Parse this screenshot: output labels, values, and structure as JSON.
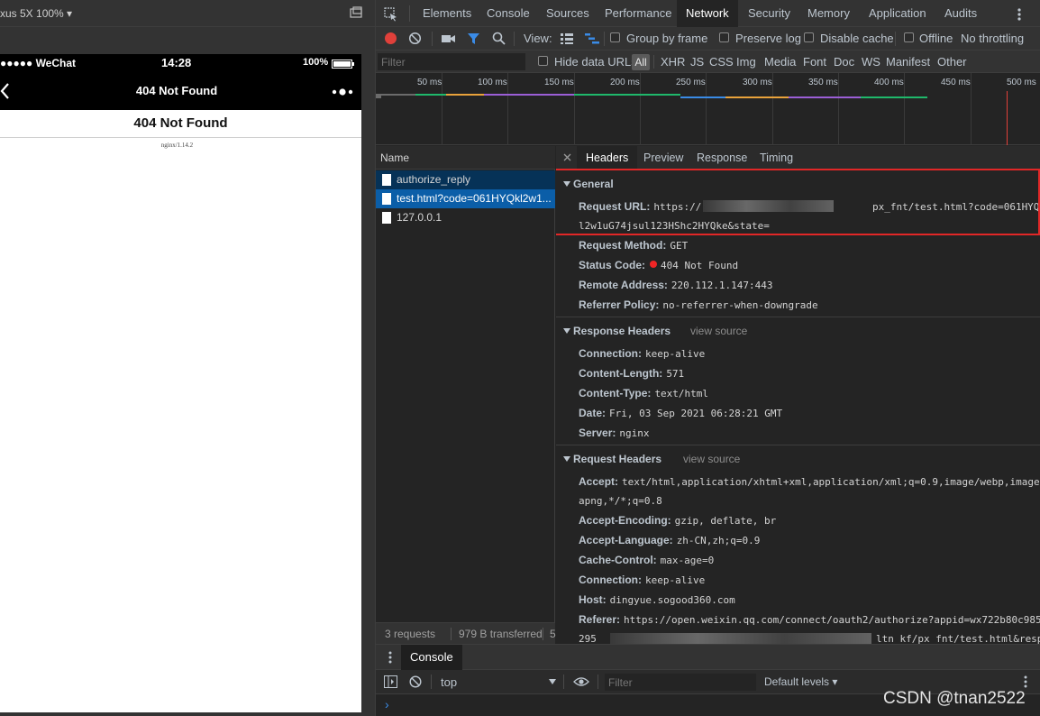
{
  "device": {
    "label": "xus 5X 100% ▾",
    "status_carrier": "●●●●● WeChat",
    "status_time": "14:28",
    "status_battery": "100%",
    "nav_title": "404 Not Found",
    "page_heading": "404 Not Found",
    "page_footer": "nginx/1.14.2"
  },
  "devtools_tabs": [
    "Elements",
    "Console",
    "Sources",
    "Performance",
    "Network",
    "Security",
    "Memory",
    "Application",
    "Audits"
  ],
  "active_tab": "Network",
  "network_toolbar": {
    "view_label": "View:",
    "group_by_frame": "Group by frame",
    "preserve_log": "Preserve log",
    "disable_cache": "Disable cache",
    "offline": "Offline",
    "throttling": "No throttling"
  },
  "filter_bar": {
    "placeholder": "Filter",
    "hide_data_urls": "Hide data URLs",
    "types": [
      "All",
      "XHR",
      "JS",
      "CSS",
      "Img",
      "Media",
      "Font",
      "Doc",
      "WS",
      "Manifest",
      "Other"
    ]
  },
  "timeline_ticks": [
    "50 ms",
    "100 ms",
    "150 ms",
    "200 ms",
    "250 ms",
    "300 ms",
    "350 ms",
    "400 ms",
    "450 ms",
    "500 ms"
  ],
  "requests": {
    "column": "Name",
    "rows": [
      "authorize_reply",
      "test.html?code=061HYQkl2w1...",
      "127.0.0.1"
    ],
    "summary_requests": "3 requests",
    "summary_transferred": "979 B transferred",
    "summary_extra": "5"
  },
  "detail_tabs": [
    "Headers",
    "Preview",
    "Response",
    "Timing"
  ],
  "general": {
    "title": "General",
    "url_key": "Request URL:",
    "url_prefix": "https://",
    "url_suffix": "px_fnt/test.html?code=061HYQ",
    "url_line2": "l2w1uG74jsul123HShc2HYQke&state=",
    "method_key": "Request Method:",
    "method_val": "GET",
    "status_key": "Status Code:",
    "status_val": "404 Not Found",
    "remote_key": "Remote Address:",
    "remote_val": "220.112.1.147:443",
    "referrer_key": "Referrer Policy:",
    "referrer_val": "no-referrer-when-downgrade"
  },
  "response_headers": {
    "title": "Response Headers",
    "view_source": "view source",
    "rows": [
      {
        "k": "Connection:",
        "v": "keep-alive"
      },
      {
        "k": "Content-Length:",
        "v": "571"
      },
      {
        "k": "Content-Type:",
        "v": "text/html"
      },
      {
        "k": "Date:",
        "v": "Fri, 03 Sep 2021 06:28:21 GMT"
      },
      {
        "k": "Server:",
        "v": "nginx"
      }
    ]
  },
  "request_headers": {
    "title": "Request Headers",
    "view_source": "view source",
    "accept_key": "Accept:",
    "accept_val": "text/html,application/xhtml+xml,application/xml;q=0.9,image/webp,image/",
    "accept_val2": "apng,*/*;q=0.8",
    "rows": [
      {
        "k": "Accept-Encoding:",
        "v": "gzip, deflate, br"
      },
      {
        "k": "Accept-Language:",
        "v": "zh-CN,zh;q=0.9"
      },
      {
        "k": "Cache-Control:",
        "v": "max-age=0"
      },
      {
        "k": "Connection:",
        "v": "keep-alive"
      },
      {
        "k": "Host:",
        "v": "dingyue.sogood360.com"
      }
    ],
    "referer_key": "Referer:",
    "referer_val": "https://open.weixin.qq.com/connect/oauth2/authorize?appid=wx722b80c985",
    "referer_line2_a": "295",
    "referer_line2_b": "ltn_kf/px_fnt/test.html&resp"
  },
  "drawer": {
    "tab": "Console",
    "context": "top",
    "filter_placeholder": "Filter",
    "levels": "Default levels ▾",
    "prompt": "›"
  },
  "watermark": "CSDN @tnan2522"
}
